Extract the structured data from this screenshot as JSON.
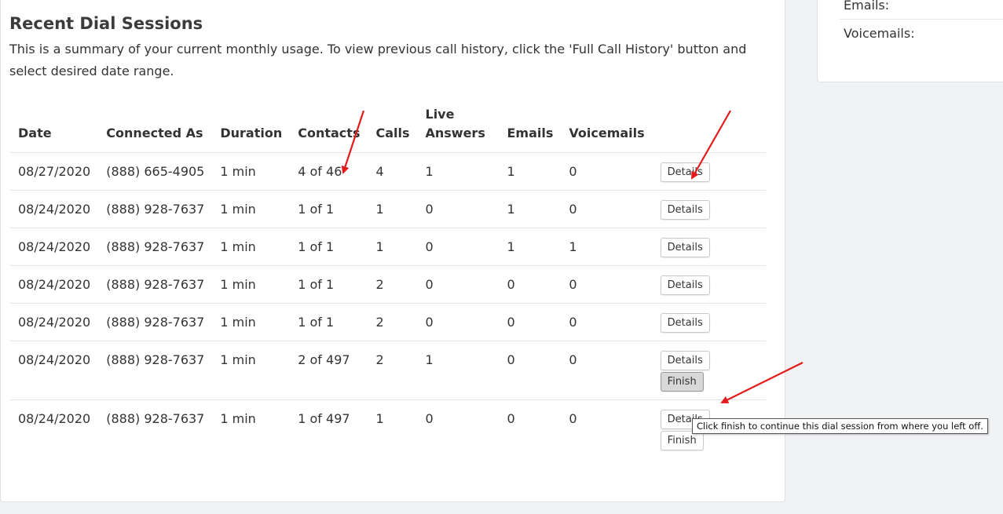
{
  "page": {
    "title": "Recent Dial Sessions",
    "summary": "This is a summary of your current monthly usage. To view previous call history, click the 'Full Call History' button and select desired date range."
  },
  "sidebar": {
    "emails_label": "Emails:",
    "voicemails_label": "Voicemails:"
  },
  "table": {
    "columns": [
      "Date",
      "Connected As",
      "Duration",
      "Contacts",
      "Calls",
      "Live Answers",
      "Emails",
      "Voicemails"
    ],
    "rows": [
      {
        "date": "08/27/2020",
        "connected_as": "(888) 665-4905",
        "duration": "1 min",
        "contacts": "4 of 46",
        "calls": "4",
        "live_answers": "1",
        "emails": "1",
        "voicemails": "0",
        "actions": [
          "Details"
        ]
      },
      {
        "date": "08/24/2020",
        "connected_as": "(888) 928-7637",
        "duration": "1 min",
        "contacts": "1 of 1",
        "calls": "1",
        "live_answers": "0",
        "emails": "1",
        "voicemails": "0",
        "actions": [
          "Details"
        ]
      },
      {
        "date": "08/24/2020",
        "connected_as": "(888) 928-7637",
        "duration": "1 min",
        "contacts": "1 of 1",
        "calls": "1",
        "live_answers": "0",
        "emails": "1",
        "voicemails": "1",
        "actions": [
          "Details"
        ]
      },
      {
        "date": "08/24/2020",
        "connected_as": "(888) 928-7637",
        "duration": "1 min",
        "contacts": "1 of 1",
        "calls": "2",
        "live_answers": "0",
        "emails": "0",
        "voicemails": "0",
        "actions": [
          "Details"
        ]
      },
      {
        "date": "08/24/2020",
        "connected_as": "(888) 928-7637",
        "duration": "1 min",
        "contacts": "1 of 1",
        "calls": "2",
        "live_answers": "0",
        "emails": "0",
        "voicemails": "0",
        "actions": [
          "Details"
        ]
      },
      {
        "date": "08/24/2020",
        "connected_as": "(888) 928-7637",
        "duration": "1 min",
        "contacts": "2 of 497",
        "calls": "2",
        "live_answers": "1",
        "emails": "0",
        "voicemails": "0",
        "actions": [
          "Details",
          "Finish"
        ]
      },
      {
        "date": "08/24/2020",
        "connected_as": "(888) 928-7637",
        "duration": "1 min",
        "contacts": "1 of 497",
        "calls": "1",
        "live_answers": "0",
        "emails": "0",
        "voicemails": "0",
        "actions": [
          "Details",
          "Finish"
        ]
      }
    ]
  },
  "tooltip": {
    "text": "Click finish to continue this dial session from where you left off."
  },
  "colors": {
    "annotation_arrow": "#e31b1b",
    "finish_active_bg": "#d8d8d8"
  }
}
